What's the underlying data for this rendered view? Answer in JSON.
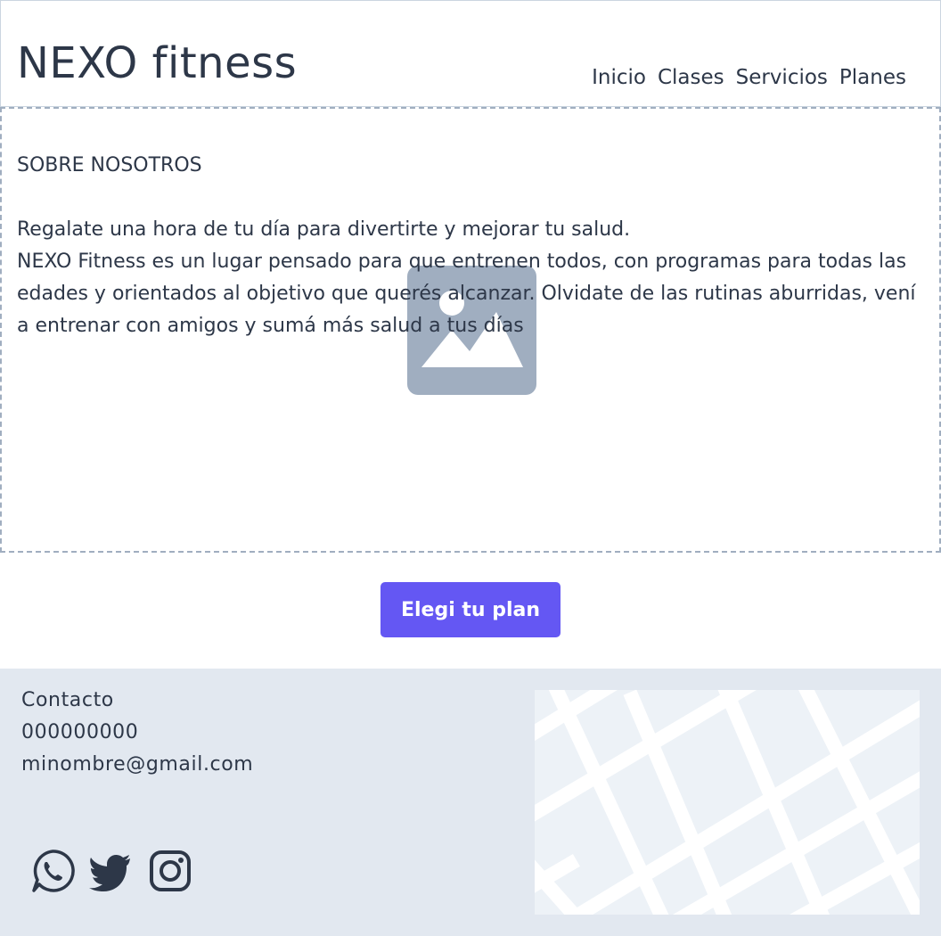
{
  "header": {
    "brand": "NEXO fitness",
    "nav": [
      {
        "label": "Inicio"
      },
      {
        "label": "Clases"
      },
      {
        "label": "Servicios"
      },
      {
        "label": "Planes"
      }
    ]
  },
  "about": {
    "title": "SOBRE NOSOTROS",
    "text": "Regalate una hora de tu día para divertirte y mejorar tu salud.\nNEXO Fitness es un lugar pensado para que entrenen todos, con programas para todas las edades y orientados al objetivo que querés alcanzar. Olvidate de las rutinas aburridas, vení a entrenar con amigos y sumá más salud a tus días",
    "image_icon": "image-placeholder-icon"
  },
  "cta": {
    "label": "Elegi tu plan"
  },
  "footer": {
    "contact_title": "Contacto",
    "phone": "000000000",
    "email": "minombre@gmail.com",
    "social": [
      "whatsapp-icon",
      "twitter-icon",
      "instagram-icon"
    ]
  },
  "colors": {
    "primary": "#6457f3",
    "text": "#2d3748",
    "footer_bg": "#e2e8f0",
    "placeholder": "#a0aec0"
  }
}
